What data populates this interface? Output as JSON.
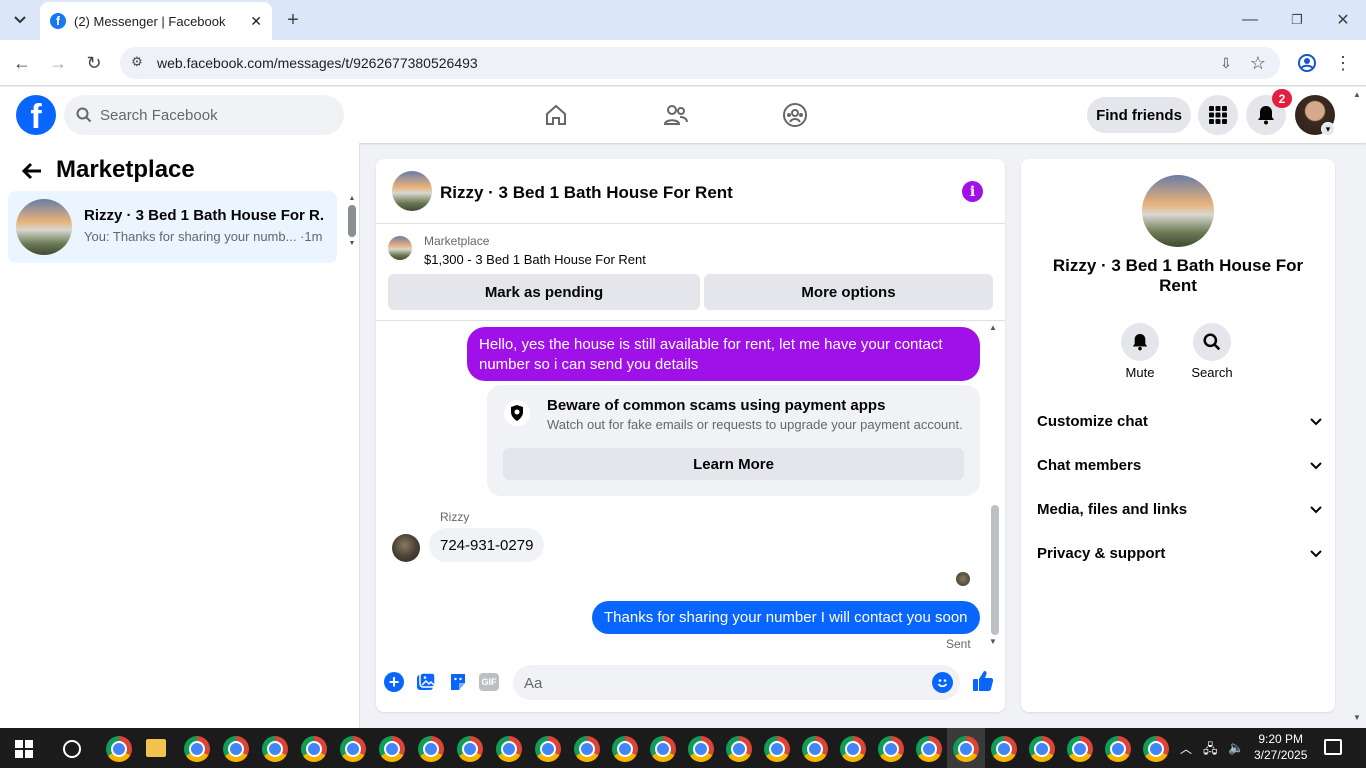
{
  "browser": {
    "tab_title": "(2) Messenger | Facebook",
    "url": "web.facebook.com/messages/t/9262677380526493"
  },
  "header": {
    "search_placeholder": "Search Facebook",
    "find_friends": "Find friends",
    "notification_count": "2"
  },
  "sidebar": {
    "title": "Marketplace",
    "conversations": [
      {
        "name": "Rizzy · 3 Bed 1 Bath House For R...",
        "preview": "You: Thanks for sharing your numb... ·1m"
      }
    ]
  },
  "chat": {
    "title": "Rizzy · 3 Bed 1 Bath House For Rent",
    "marketplace_label": "Marketplace",
    "listing": "$1,300 - 3 Bed 1 Bath House For Rent",
    "mark_pending": "Mark as pending",
    "more_options": "More options",
    "messages": {
      "out1": "Hello, yes the house is still available for rent, let me have your contact number so i can send you  details",
      "warning_title": "Beware of common scams using payment apps",
      "warning_sub": "Watch out for fake emails or requests to upgrade your payment account.",
      "learn_more": "Learn More",
      "sender": "Rizzy",
      "in1": "724-931-0279",
      "out2": "Thanks for sharing your number I will contact you soon",
      "status": "Sent"
    },
    "composer_placeholder": "Aa"
  },
  "details": {
    "name": "Rizzy · 3 Bed 1 Bath House For Rent",
    "mute": "Mute",
    "search": "Search",
    "sections": [
      "Customize chat",
      "Chat members",
      "Media, files and links",
      "Privacy & support"
    ]
  },
  "taskbar": {
    "time": "9:20 PM",
    "date": "3/27/2025"
  },
  "colors": {
    "brand": "#0866ff",
    "accent": "#a010e8"
  }
}
